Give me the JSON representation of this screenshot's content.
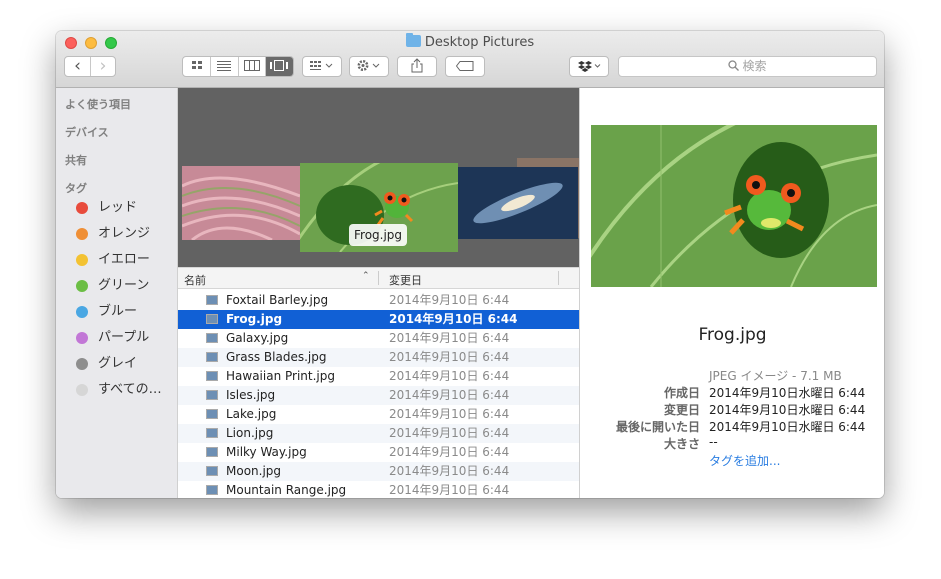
{
  "window": {
    "title": "Desktop Pictures"
  },
  "toolbar": {
    "back_glyph": "‹",
    "forward_glyph": "›",
    "search_placeholder": "検索",
    "icons": [
      "icon-view-icon",
      "list-view-icon",
      "column-view-icon",
      "coverflow-view-icon",
      "arrange-icon",
      "action-gear-icon",
      "share-icon",
      "tag-icon",
      "dropbox-icon"
    ]
  },
  "sidebar": {
    "headings": [
      "よく使う項目",
      "デバイス",
      "共有",
      "タグ"
    ],
    "tags": [
      {
        "label": "レッド",
        "color": "#e84b3c"
      },
      {
        "label": "オレンジ",
        "color": "#ef8f36"
      },
      {
        "label": "イエロー",
        "color": "#f3c232"
      },
      {
        "label": "グリーン",
        "color": "#6cbe45"
      },
      {
        "label": "ブルー",
        "color": "#4aa7e3"
      },
      {
        "label": "パープル",
        "color": "#c277d6"
      },
      {
        "label": "グレイ",
        "color": "#8e8e8e"
      },
      {
        "label": "すべての…",
        "color": "#d6d6d6"
      }
    ]
  },
  "coverflow": {
    "caption": "Frog.jpg"
  },
  "list": {
    "col_name": "名前",
    "col_date": "変更日",
    "sort_glyph": "⌃",
    "rows": [
      {
        "name": "Foxtail Barley.jpg",
        "date": "2014年9月10日 6:44"
      },
      {
        "name": "Frog.jpg",
        "date": "2014年9月10日 6:44",
        "selected": true
      },
      {
        "name": "Galaxy.jpg",
        "date": "2014年9月10日 6:44"
      },
      {
        "name": "Grass Blades.jpg",
        "date": "2014年9月10日 6:44"
      },
      {
        "name": "Hawaiian Print.jpg",
        "date": "2014年9月10日 6:44"
      },
      {
        "name": "Isles.jpg",
        "date": "2014年9月10日 6:44"
      },
      {
        "name": "Lake.jpg",
        "date": "2014年9月10日 6:44"
      },
      {
        "name": "Lion.jpg",
        "date": "2014年9月10日 6:44"
      },
      {
        "name": "Milky Way.jpg",
        "date": "2014年9月10日 6:44"
      },
      {
        "name": "Moon.jpg",
        "date": "2014年9月10日 6:44"
      },
      {
        "name": "Mountain Range.jpg",
        "date": "2014年9月10日 6:44"
      }
    ]
  },
  "preview": {
    "filename": "Frog.jpg",
    "kind": "JPEG イメージ - 7.1 MB",
    "meta": [
      {
        "label": "作成日",
        "value": "2014年9月10日水曜日 6:44"
      },
      {
        "label": "変更日",
        "value": "2014年9月10日水曜日 6:44"
      },
      {
        "label": "最後に開いた日",
        "value": "2014年9月10日水曜日 6:44"
      },
      {
        "label": "大きさ",
        "value": "--"
      }
    ],
    "add_tags": "タグを追加..."
  },
  "colors": {
    "selection": "#1160d5",
    "link": "#2a7de1"
  }
}
